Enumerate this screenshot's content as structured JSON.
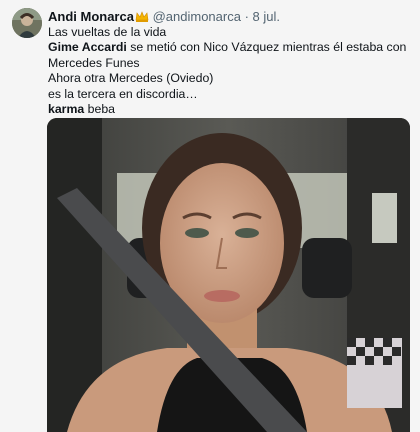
{
  "tweet": {
    "author_name": "Andi Monarca",
    "handle": "@andimonarca",
    "separator": "·",
    "date": "8 jul.",
    "lines": {
      "l1": "Las vueltas de la vida",
      "l2_bold": "Gime Accardi",
      "l2_rest": " se metió con Nico Vázquez mientras él estaba con Mercedes Funes",
      "l3": "Ahora otra Mercedes (Oviedo)",
      "l4": "es la tercera en discordia…",
      "l5_bold": "karma",
      "l5_rest": " beba"
    }
  },
  "icons": {
    "crown": "crown-emoji-icon",
    "avatar": "avatar-photo"
  },
  "colors": {
    "text": "#0f1419",
    "muted": "#536471",
    "background": "#f5f5f5",
    "crown": "#f4b400"
  }
}
